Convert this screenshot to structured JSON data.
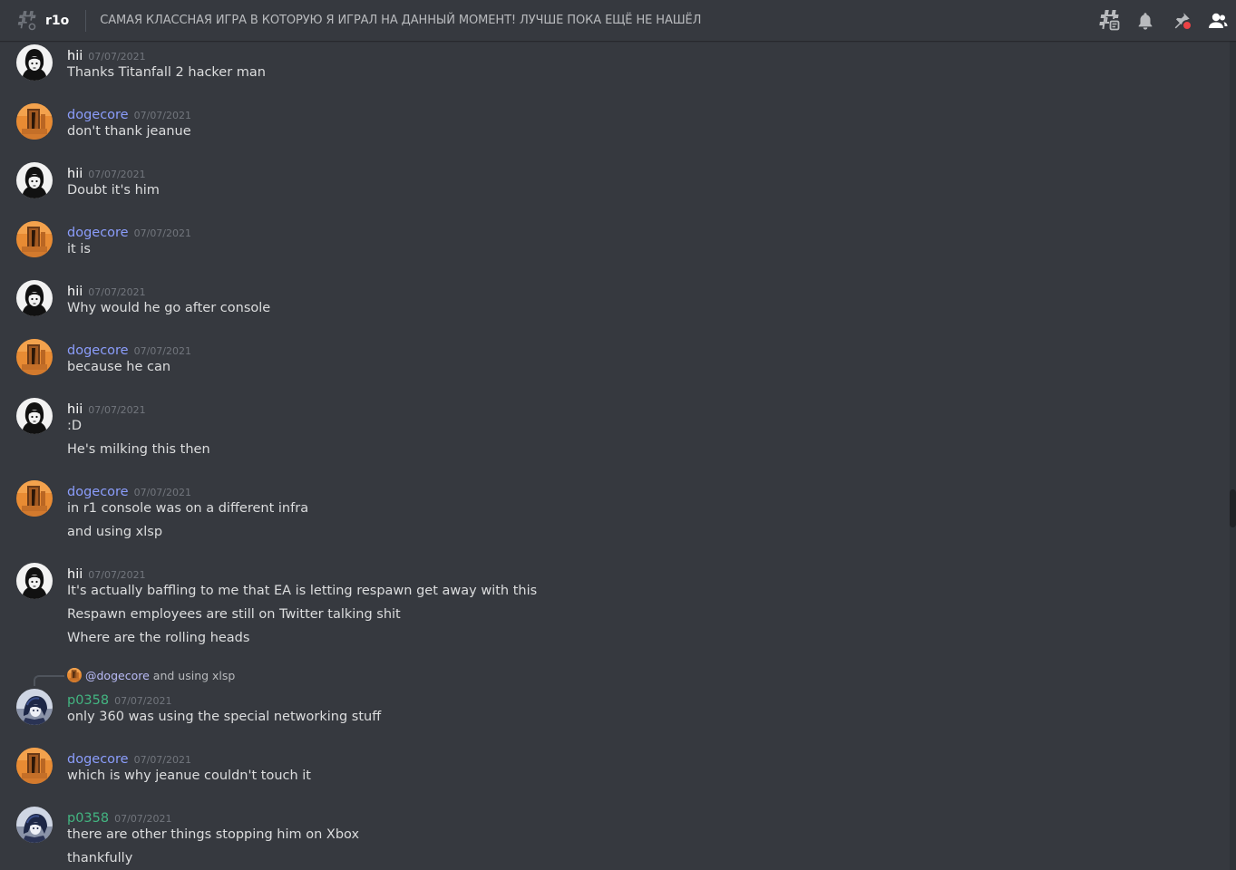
{
  "header": {
    "channel_icon": "hashtag-threads-icon",
    "channel_name": "r1o",
    "topic": "САМАЯ КЛАССНАЯ ИГРА В КОТОРУЮ Я ИГРАЛ НА ДАННЫЙ МОМЕНТ! ЛУЧШЕ ПОКА ЕЩЁ НЕ НАШЁЛ",
    "toolbar": [
      "threads-icon",
      "bell-icon",
      "pin-icon",
      "members-icon"
    ]
  },
  "colors": {
    "background": "#36393f",
    "hii": "#ffffff",
    "dogecore": "#8b9dfb",
    "p0358": "#43b581",
    "notification_dot": "#ed4245"
  },
  "messages": [
    {
      "author": "hii",
      "timestamp": "07/07/2021",
      "lines": [
        "Thanks Titanfall 2 hacker man"
      ]
    },
    {
      "author": "dogecore",
      "timestamp": "07/07/2021",
      "lines": [
        "don't thank jeanue"
      ]
    },
    {
      "author": "hii",
      "timestamp": "07/07/2021",
      "lines": [
        "Doubt it's him"
      ]
    },
    {
      "author": "dogecore",
      "timestamp": "07/07/2021",
      "lines": [
        "it is"
      ]
    },
    {
      "author": "hii",
      "timestamp": "07/07/2021",
      "lines": [
        "Why would he go after console"
      ]
    },
    {
      "author": "dogecore",
      "timestamp": "07/07/2021",
      "lines": [
        "because he can"
      ]
    },
    {
      "author": "hii",
      "timestamp": "07/07/2021",
      "lines": [
        ":D",
        "He's milking this then"
      ]
    },
    {
      "author": "dogecore",
      "timestamp": "07/07/2021",
      "lines": [
        "in r1 console was on a different infra",
        "and using xlsp"
      ]
    },
    {
      "author": "hii",
      "timestamp": "07/07/2021",
      "lines": [
        "It's actually baffling to me that EA is letting respawn get away with this",
        "Respawn employees are still on Twitter talking shit",
        "Where are the rolling heads"
      ]
    },
    {
      "author": "p0358",
      "timestamp": "07/07/2021",
      "lines": [
        "only 360 was using the special networking stuff"
      ]
    },
    {
      "author": "dogecore",
      "timestamp": "07/07/2021",
      "lines": [
        "which is why jeanue couldn't touch it"
      ]
    },
    {
      "author": "p0358",
      "timestamp": "07/07/2021",
      "lines": [
        "there are other things stopping him on Xbox",
        "thankfully"
      ]
    }
  ],
  "reply": {
    "mention": "@dogecore",
    "text": "and using xlsp"
  }
}
